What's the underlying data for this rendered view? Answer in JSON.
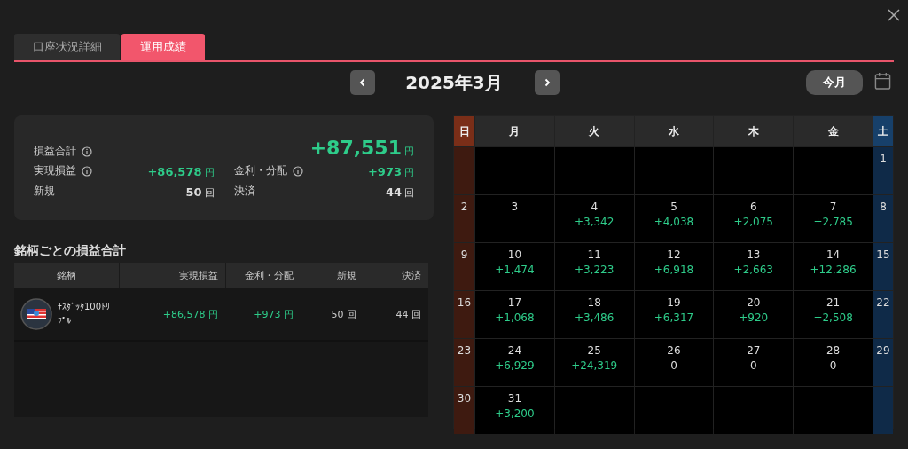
{
  "tabs": [
    {
      "label": "口座状況詳細",
      "selected": false
    },
    {
      "label": "運用成績",
      "selected": true
    }
  ],
  "month_nav": {
    "title": "2025年3月",
    "today_button": "今月"
  },
  "summary": {
    "total": {
      "label": "損益合計",
      "value": "+87,551",
      "unit": "円"
    },
    "items": [
      {
        "label": "実現損益",
        "info": true,
        "value": "+86,578",
        "unit": "円",
        "positive": true
      },
      {
        "label": "金利・分配",
        "info": true,
        "value": "+973",
        "unit": "円",
        "positive": true
      },
      {
        "label": "新規",
        "info": false,
        "value": "50",
        "unit": "回",
        "positive": false
      },
      {
        "label": "決済",
        "info": false,
        "value": "44",
        "unit": "回",
        "positive": false
      }
    ]
  },
  "symbols": {
    "title": "銘柄ごとの損益合計",
    "columns": [
      "銘柄",
      "実現損益",
      "金利・分配",
      "新規",
      "決済"
    ],
    "rows": [
      {
        "name": "ﾅｽﾀﾞｯｸ100ﾄﾘﾌﾟﾙ",
        "realized": "+86,578 円",
        "interest": "+973 円",
        "new": "50 回",
        "closed": "44 回"
      }
    ]
  },
  "calendar": {
    "weekdays": [
      {
        "label": "日",
        "kind": "sun"
      },
      {
        "label": "月",
        "kind": "weekday"
      },
      {
        "label": "火",
        "kind": "weekday"
      },
      {
        "label": "水",
        "kind": "weekday"
      },
      {
        "label": "木",
        "kind": "weekday"
      },
      {
        "label": "金",
        "kind": "weekday"
      },
      {
        "label": "土",
        "kind": "sat"
      }
    ],
    "weeks": [
      [
        {
          "kind": "empty"
        },
        {
          "kind": "empty"
        },
        {
          "kind": "empty"
        },
        {
          "kind": "empty"
        },
        {
          "kind": "empty"
        },
        {
          "kind": "empty"
        },
        {
          "kind": "day",
          "day": "1"
        }
      ],
      [
        {
          "kind": "day",
          "day": "2"
        },
        {
          "kind": "day",
          "day": "3"
        },
        {
          "kind": "day",
          "day": "4",
          "pnl": "+3,342",
          "positive": true
        },
        {
          "kind": "day",
          "day": "5",
          "pnl": "+4,038",
          "positive": true
        },
        {
          "kind": "day",
          "day": "6",
          "pnl": "+2,075",
          "positive": true
        },
        {
          "kind": "day",
          "day": "7",
          "pnl": "+2,785",
          "positive": true
        },
        {
          "kind": "day",
          "day": "8"
        }
      ],
      [
        {
          "kind": "day",
          "day": "9"
        },
        {
          "kind": "day",
          "day": "10",
          "pnl": "+1,474",
          "positive": true
        },
        {
          "kind": "day",
          "day": "11",
          "pnl": "+3,223",
          "positive": true
        },
        {
          "kind": "day",
          "day": "12",
          "pnl": "+6,918",
          "positive": true
        },
        {
          "kind": "day",
          "day": "13",
          "pnl": "+2,663",
          "positive": true
        },
        {
          "kind": "day",
          "day": "14",
          "pnl": "+12,286",
          "positive": true
        },
        {
          "kind": "day",
          "day": "15"
        }
      ],
      [
        {
          "kind": "day",
          "day": "16"
        },
        {
          "kind": "day",
          "day": "17",
          "pnl": "+1,068",
          "positive": true
        },
        {
          "kind": "day",
          "day": "18",
          "pnl": "+3,486",
          "positive": true
        },
        {
          "kind": "day",
          "day": "19",
          "pnl": "+6,317",
          "positive": true
        },
        {
          "kind": "day",
          "day": "20",
          "pnl": "+920",
          "positive": true
        },
        {
          "kind": "day",
          "day": "21",
          "pnl": "+2,508",
          "positive": true
        },
        {
          "kind": "day",
          "day": "22"
        }
      ],
      [
        {
          "kind": "day",
          "day": "23"
        },
        {
          "kind": "day",
          "day": "24",
          "pnl": "+6,929",
          "positive": true
        },
        {
          "kind": "day",
          "day": "25",
          "pnl": "+24,319",
          "positive": true
        },
        {
          "kind": "day",
          "day": "26",
          "pnl": "0",
          "positive": false
        },
        {
          "kind": "day",
          "day": "27",
          "pnl": "0",
          "positive": false
        },
        {
          "kind": "day",
          "day": "28",
          "pnl": "0",
          "positive": false
        },
        {
          "kind": "day",
          "day": "29"
        }
      ],
      [
        {
          "kind": "day",
          "day": "30"
        },
        {
          "kind": "day",
          "day": "31",
          "pnl": "+3,200",
          "positive": true
        },
        {
          "kind": "empty"
        },
        {
          "kind": "empty"
        },
        {
          "kind": "empty"
        },
        {
          "kind": "empty"
        },
        {
          "kind": "empty"
        }
      ]
    ]
  }
}
